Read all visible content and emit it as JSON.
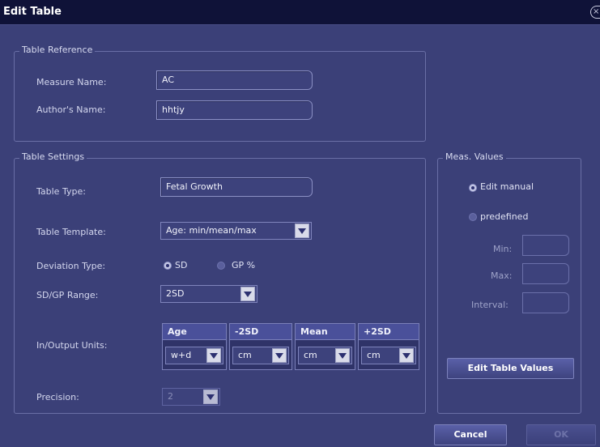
{
  "window": {
    "title": "Edit Table"
  },
  "table_reference": {
    "group_title": "Table Reference",
    "measure_name_label": "Measure Name:",
    "measure_name_value": "AC",
    "author_name_label": "Author's Name:",
    "author_name_value": "hhtjy"
  },
  "table_settings": {
    "group_title": "Table Settings",
    "table_type_label": "Table Type:",
    "table_type_value": "Fetal Growth",
    "table_template_label": "Table Template:",
    "table_template_value": "Age: min/mean/max",
    "deviation_type_label": "Deviation Type:",
    "deviation_options": [
      {
        "label": "SD",
        "selected": true
      },
      {
        "label": "GP %",
        "selected": false
      }
    ],
    "sd_gp_range_label": "SD/GP Range:",
    "sd_gp_range_value": "2SD",
    "io_units_label": "In/Output Units:",
    "units": [
      {
        "header": "Age",
        "value": "w+d"
      },
      {
        "header": "-2SD",
        "value": "cm"
      },
      {
        "header": "Mean",
        "value": "cm"
      },
      {
        "header": "+2SD",
        "value": "cm"
      }
    ],
    "precision_label": "Precision:",
    "precision_value": "2"
  },
  "meas_values": {
    "group_title": "Meas. Values",
    "options": [
      {
        "label": "Edit manual",
        "selected": true
      },
      {
        "label": "predefined",
        "selected": false
      }
    ],
    "min_label": "Min:",
    "max_label": "Max:",
    "interval_label": "Interval:",
    "edit_button": "Edit Table Values"
  },
  "footer": {
    "cancel_button": "Cancel",
    "ok_button": "OK"
  }
}
